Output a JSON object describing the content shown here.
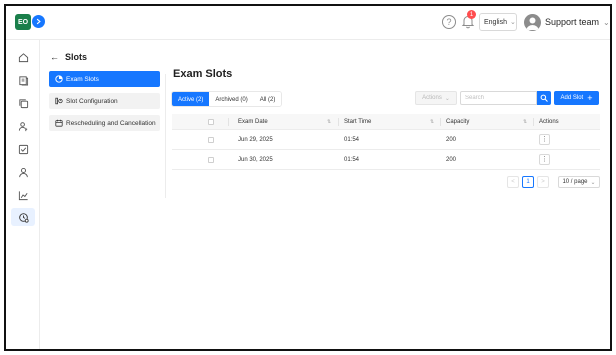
{
  "app": {
    "logo_text": "EO"
  },
  "header": {
    "notification_count": "1",
    "language": "English",
    "user_name": "Support team"
  },
  "rail": {
    "items": [
      "home-icon",
      "library-icon",
      "copy-icon",
      "user-key-icon",
      "checkbox-icon",
      "person-icon",
      "chart-icon",
      "settings-clock-icon"
    ],
    "active_item": "settings-clock-icon"
  },
  "subnav": {
    "title": "Slots",
    "items": [
      {
        "label": "Exam Slots",
        "icon": "clock-icon",
        "active": true
      },
      {
        "label": "Slot Configuration",
        "icon": "config-icon",
        "active": false
      },
      {
        "label": "Rescheduling and Cancellation",
        "icon": "calendar-icon",
        "active": false
      }
    ]
  },
  "main": {
    "title": "Exam Slots",
    "tabs": [
      {
        "label": "Active (2)",
        "active": true
      },
      {
        "label": "Archived (0)",
        "active": false
      },
      {
        "label": "All (2)",
        "active": false
      }
    ],
    "actions_label": "Actions",
    "search_placeholder": "Search",
    "add_label": "Add Slot"
  },
  "table": {
    "columns": [
      "Exam Date",
      "Start Time",
      "Capacity",
      "Actions"
    ],
    "rows": [
      {
        "exam_date": "Jun 29, 2025",
        "start_time": "01:54",
        "capacity": "200"
      },
      {
        "exam_date": "Jun 30, 2025",
        "start_time": "01:54",
        "capacity": "200"
      }
    ]
  },
  "pagination": {
    "prev": "<",
    "current_page": "1",
    "next": ">",
    "page_size": "10 / page"
  },
  "colors": {
    "primary": "#1677ff",
    "brand": "#1a7f4b",
    "badge": "#ff4d4f"
  }
}
